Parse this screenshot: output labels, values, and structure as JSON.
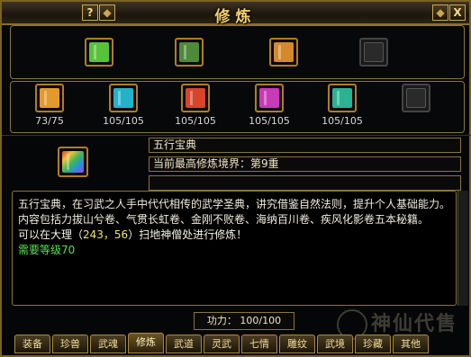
{
  "window": {
    "title": "修炼",
    "help_label": "?",
    "close_label": "X"
  },
  "row1": [
    {
      "icon": "book-green-gold-icon",
      "color": "#58c23a",
      "empty": false
    },
    {
      "icon": "book-bundle-icon",
      "color": "#4d8a3a",
      "empty": false
    },
    {
      "icon": "book-gold-stack-icon",
      "color": "#d38a2a",
      "empty": false
    },
    {
      "icon": "empty-slot-icon",
      "color": "#222222",
      "empty": true
    }
  ],
  "row2": [
    {
      "icon": "book-orange-icon",
      "color": "#e49a2a",
      "count": "73/75",
      "empty": false
    },
    {
      "icon": "book-cyan-icon",
      "color": "#23b3c8",
      "count": "105/105",
      "empty": false
    },
    {
      "icon": "book-red-icon",
      "color": "#d8452a",
      "count": "105/105",
      "empty": false
    },
    {
      "icon": "book-magenta-icon",
      "color": "#c83ab8",
      "count": "105/105",
      "empty": false
    },
    {
      "icon": "book-teal-icon",
      "color": "#2ab392",
      "count": "105/105",
      "empty": false
    },
    {
      "icon": "empty-slot-icon",
      "color": "#222222",
      "count": "",
      "empty": true
    }
  ],
  "selected": {
    "icon": "book-rainbow-icon",
    "name": "五行宝典",
    "realm": "当前最高修炼境界：第9重",
    "extra": ""
  },
  "description": {
    "text": "五行宝典，在习武之人手中代代相传的武学圣典，讲究借鉴自然法则，提升个人基础能力。内容包括力拔山兮卷、气贯长虹卷、金刚不败卷、海纳百川卷、疾风化影卷五本秘籍。",
    "location_prefix": "可以在大理（",
    "location_coords": "243，56",
    "location_suffix": "）扫地神僧处进行修炼！",
    "requirement": "需要等级70"
  },
  "power": {
    "label": "功力：",
    "value": "100/100"
  },
  "tabs": [
    "装备",
    "珍兽",
    "武魂",
    "修炼",
    "武道",
    "灵武",
    "七情",
    "雕纹",
    "武境",
    "珍藏",
    "其他"
  ],
  "active_tab_index": 3,
  "watermark": "神仙代售"
}
